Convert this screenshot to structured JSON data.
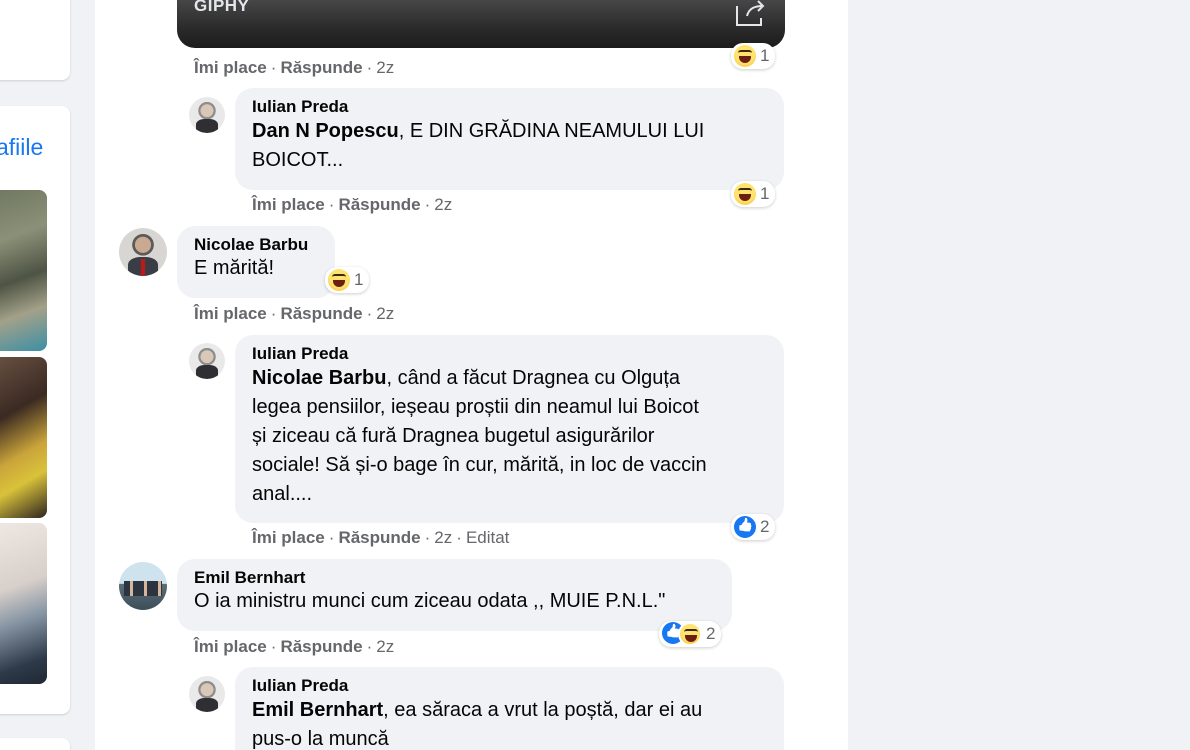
{
  "left_column": {
    "photos_link": "afiile"
  },
  "giphy": {
    "label": "GIPHY",
    "share_icon": "share-icon"
  },
  "comments": [
    {
      "id": "c0",
      "actions": {
        "like": "Îmi place",
        "reply": "Răspunde",
        "time": "2z"
      },
      "reaction": {
        "types": [
          "haha"
        ],
        "count": "1"
      }
    },
    {
      "id": "c1",
      "author": "Iulian Preda",
      "mention": "Dan N Popescu",
      "text_line1": ", E DIN GRĂDINA NEAMULUI LUI",
      "text_line2": "BOICOT...",
      "actions": {
        "like": "Îmi place",
        "reply": "Răspunde",
        "time": "2z"
      },
      "reaction": {
        "types": [
          "haha"
        ],
        "count": "1"
      }
    },
    {
      "id": "c2",
      "author": "Nicolae Barbu",
      "text": "E mărită!",
      "actions": {
        "like": "Îmi place",
        "reply": "Răspunde",
        "time": "2z"
      },
      "reaction": {
        "types": [
          "haha"
        ],
        "count": "1"
      }
    },
    {
      "id": "c3",
      "author": "Iulian Preda",
      "mention": "Nicolae Barbu",
      "text_line1": ", când a făcut Dragnea cu Olguța",
      "text_line2": "legea pensiilor, ieșeau proștii din neamul lui Boicot",
      "text_line3": "și ziceau că fură Dragnea bugetul asigurărilor",
      "text_line4": "sociale! Să și-o bage în cur, mărită, in loc de vaccin",
      "text_line5": "anal....",
      "actions": {
        "like": "Îmi place",
        "reply": "Răspunde",
        "time": "2z",
        "edited": "Editat"
      },
      "reaction": {
        "types": [
          "like"
        ],
        "count": "2"
      }
    },
    {
      "id": "c4",
      "author": "Emil Bernhart",
      "text": "O ia ministru munci cum ziceau odata ,, MUIE P.N.L.\"",
      "actions": {
        "like": "Îmi place",
        "reply": "Răspunde",
        "time": "2z"
      },
      "reaction": {
        "types": [
          "like",
          "haha"
        ],
        "count": "2"
      }
    },
    {
      "id": "c5",
      "author": "Iulian Preda",
      "mention": "Emil Bernhart",
      "text_line1": ", ea săraca a vrut la poștă, dar ei au",
      "text_line2": "pus-o la muncă"
    }
  ],
  "separator": "·",
  "colors": {
    "link": "#1877f2",
    "bubble": "#f0f2f5",
    "meta": "#65676b",
    "like_blue": "#1877f2"
  }
}
